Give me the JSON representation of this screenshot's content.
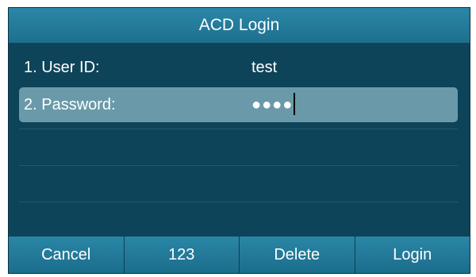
{
  "title": "ACD Login",
  "fields": [
    {
      "label": "1. User ID:",
      "value": "test"
    },
    {
      "label": "2. Password:",
      "value": "●●●●"
    }
  ],
  "softkeys": {
    "cancel": "Cancel",
    "mode": "123",
    "delete": "Delete",
    "login": "Login"
  },
  "colors": {
    "screen_bg": "#0e4459",
    "title_bar": "#1e6f8e",
    "selected_row": "#6a9aa9",
    "softkey_bg": "#1c6d8c"
  }
}
